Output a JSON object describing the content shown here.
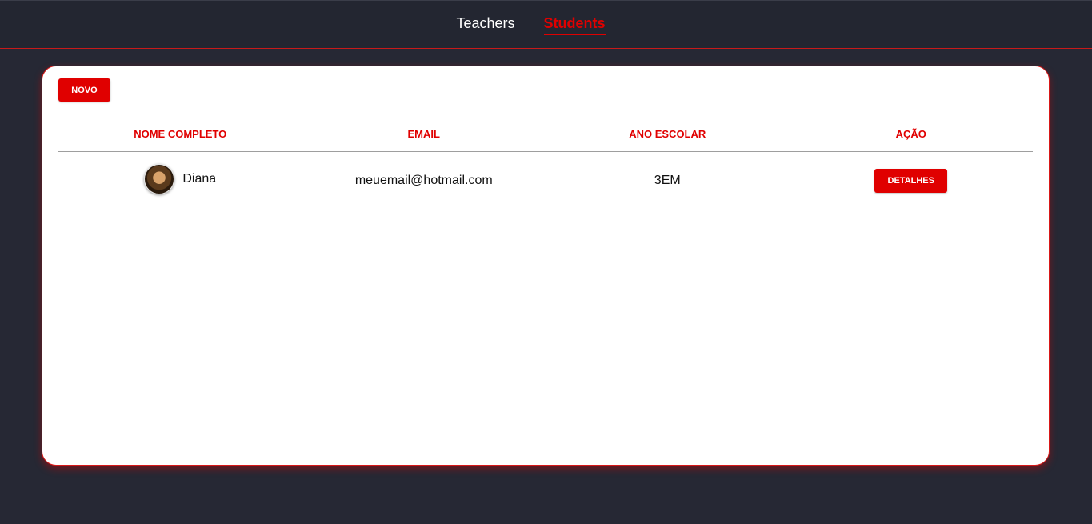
{
  "nav": {
    "tabs": [
      {
        "label": "Teachers",
        "active": false
      },
      {
        "label": "Students",
        "active": true
      }
    ]
  },
  "toolbar": {
    "new_label": "NOVO"
  },
  "table": {
    "headers": [
      "NOME COMPLETO",
      "EMAIL",
      "ANO ESCOLAR",
      "AÇÃO"
    ],
    "rows": [
      {
        "name": "Diana",
        "email": "meuemail@hotmail.com",
        "year": "3EM",
        "action_label": "DETALHES"
      }
    ]
  },
  "colors": {
    "accent": "#e00000",
    "background": "#262834",
    "card": "#ffffff"
  }
}
